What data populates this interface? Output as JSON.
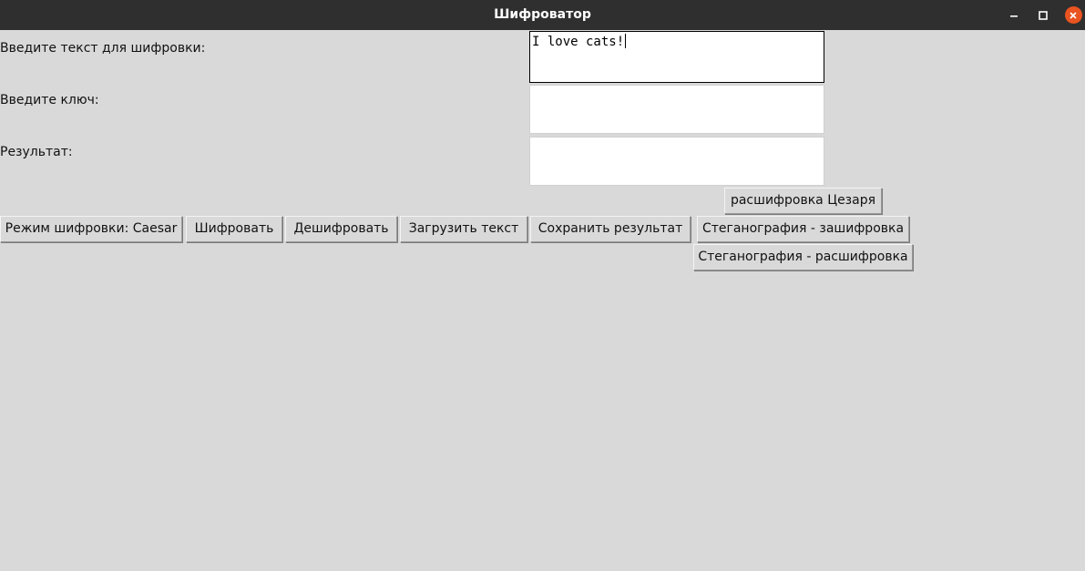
{
  "window": {
    "title": "Шифроватор"
  },
  "form": {
    "text_label": "Введите текст для шифровки:",
    "text_value": "I love cats!",
    "key_label": "Введите ключ:",
    "key_value": "",
    "result_label": "Результат:",
    "result_value": ""
  },
  "buttons": {
    "caesar_decrypt": "расшифровка Цезаря",
    "mode": "Режим шифровки: Caesar",
    "encrypt": "Шифровать",
    "decrypt": "Дешифровать",
    "load_text": "Загрузить текст",
    "save_result": "Сохранить результат",
    "stego_encrypt": "Стеганография - зашифровка",
    "stego_decrypt": "Стеганография - расшифровка"
  },
  "icons": {
    "minimize": "minimize-icon",
    "maximize": "maximize-icon",
    "close": "close-icon"
  },
  "colors": {
    "background": "#d9d9d9",
    "titlebar": "#2f2f2f",
    "close_accent": "#e95420"
  }
}
